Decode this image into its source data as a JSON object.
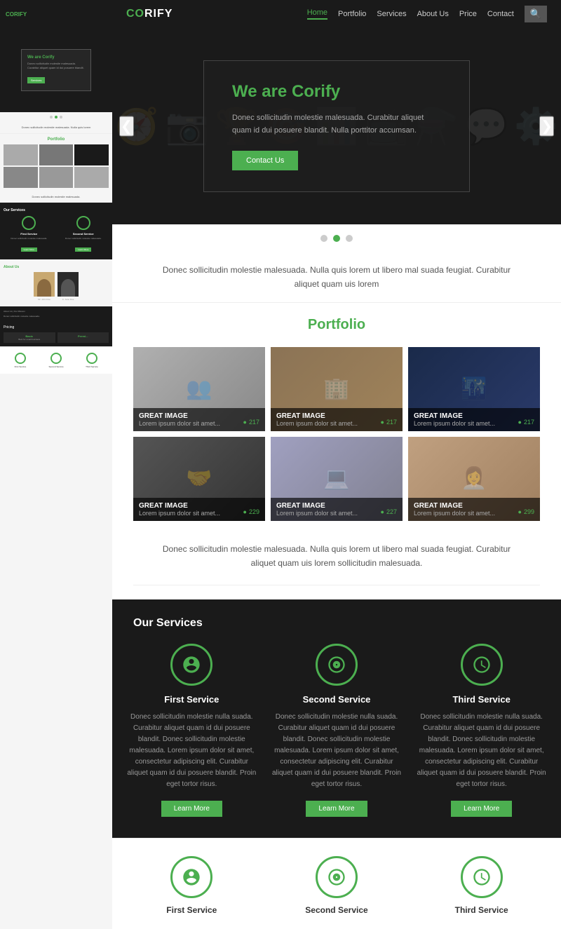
{
  "header": {
    "logo": "CORIFY",
    "logo_accent": "CO",
    "nav": [
      "Home",
      "Portfolio",
      "Services",
      "About Us",
      "Price",
      "Contact"
    ],
    "active_nav": "Home",
    "search_label": "🔍"
  },
  "hero": {
    "title": "We are Corify",
    "text": "Donec sollicitudin molestie malesuada. Curabitur aliquet quam id dui posuere blandit. Nulla porttitor accumsan.",
    "cta": "Contact Us",
    "arrow_left": "❮",
    "arrow_right": "❯"
  },
  "intro": {
    "text": "Donec sollicitudin molestie malesuada. Nulla quis lorem ut libero mal suada feugiat. Curabitur aliquet quam uis lorem"
  },
  "portfolio": {
    "title": "Portfolio",
    "items": [
      {
        "title": "GREAT IMAGE",
        "sub": "Lorem ipsum dolor sit amet...",
        "count": "217"
      },
      {
        "title": "GREAT IMAGE",
        "sub": "Lorem ipsum dolor sit amet...",
        "count": "217"
      },
      {
        "title": "GREAT IMAGE",
        "sub": "Lorem ipsum dolor sit amet...",
        "count": "217"
      },
      {
        "title": "GREAT IMAGE",
        "sub": "Lorem ipsum dolor sit amet...",
        "count": "229"
      },
      {
        "title": "GREAT IMAGE",
        "sub": "Lorem ipsum dolor sit amet...",
        "count": "227"
      },
      {
        "title": "GREAT IMAGE",
        "sub": "Lorem ipsum dolor sit amet...",
        "count": "299"
      }
    ],
    "outro": "Donec sollicitudin molestie malesuada. Nulla quis lorem ut libero mal suada feugiat. Curabitur\naliquet quam uis lorem sollicitudin malesuada."
  },
  "services_dark": {
    "title": "Our Services",
    "items": [
      {
        "name": "First Service",
        "desc": "Donec sollicitudin molestie nulla suada. Curabitur aliquet quam id dui posuere blandit. Donec sollicitudin molestie malesuada. Lorem ipsum dolor sit amet, consectetur adipiscing elit. Curabitur aliquet quam id dui posuere blandit. Proin eget tortor risus.",
        "btn": "Learn More"
      },
      {
        "name": "Second Service",
        "desc": "Donec sollicitudin molestie nulla suada. Curabitur aliquet quam id dui posuere blandit. Donec sollicitudin molestie malesuada. Lorem ipsum dolor sit amet, consectetur adipiscing elit. Curabitur aliquet quam id dui posuere blandit. Proin eget tortor risus.",
        "btn": "Learn More"
      },
      {
        "name": "Third Service",
        "desc": "Donec sollicitudin molestie nulla suada. Curabitur aliquet quam id dui posuere blandit. Donec sollicitudin molestie malesuada. Lorem ipsum dolor sit amet, consectetur adipiscing elit. Curabitur aliquet quam id dui posuere blandit. Proin eget tortor risus.",
        "btn": "Learn More"
      }
    ]
  },
  "services_white": {
    "items": [
      {
        "name": "First Service"
      },
      {
        "name": "Second Service"
      },
      {
        "name": "Third Service"
      }
    ]
  },
  "colors": {
    "accent": "#4caf50",
    "dark": "#1a1a1a",
    "text": "#555"
  }
}
